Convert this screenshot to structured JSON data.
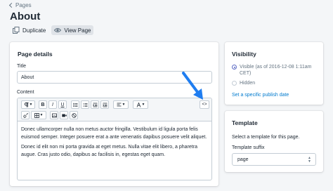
{
  "breadcrumb": {
    "label": "Pages"
  },
  "page": {
    "title": "About"
  },
  "actions": {
    "duplicate": "Duplicate",
    "view_page": "View Page"
  },
  "details": {
    "heading": "Page details",
    "title_label": "Title",
    "title_value": "About",
    "content_label": "Content",
    "toolbar": {
      "bold": "B",
      "italic": "I",
      "underline": "U",
      "code_toggle": "<>"
    },
    "paragraphs": [
      "Donec ullamcorper nulla non metus auctor fringilla. Vestibulum id ligula porta felis euismod semper. Integer posuere erat a ante venenatis dapibus posuere velit aliquet.",
      "Donec id elit non mi porta gravida at eget metus. Nulla vitae elit libero, a pharetra augue. Cras justo odio, dapibus ac facilisis in, egestas eget quam."
    ]
  },
  "visibility": {
    "heading": "Visibility",
    "visible_line1": "Visible (as of 2016-12-08 1:11am",
    "visible_line2": "CET)",
    "hidden": "Hidden",
    "publish_link": "Set a specific publish date"
  },
  "template": {
    "heading": "Template",
    "description": "Select a template for this page.",
    "suffix_label": "Template suffix",
    "suffix_value": "page"
  },
  "colors": {
    "accent": "#5c6ac4",
    "link": "#007ace",
    "arrow": "#1f7df0",
    "background": "#f4f6f8"
  }
}
